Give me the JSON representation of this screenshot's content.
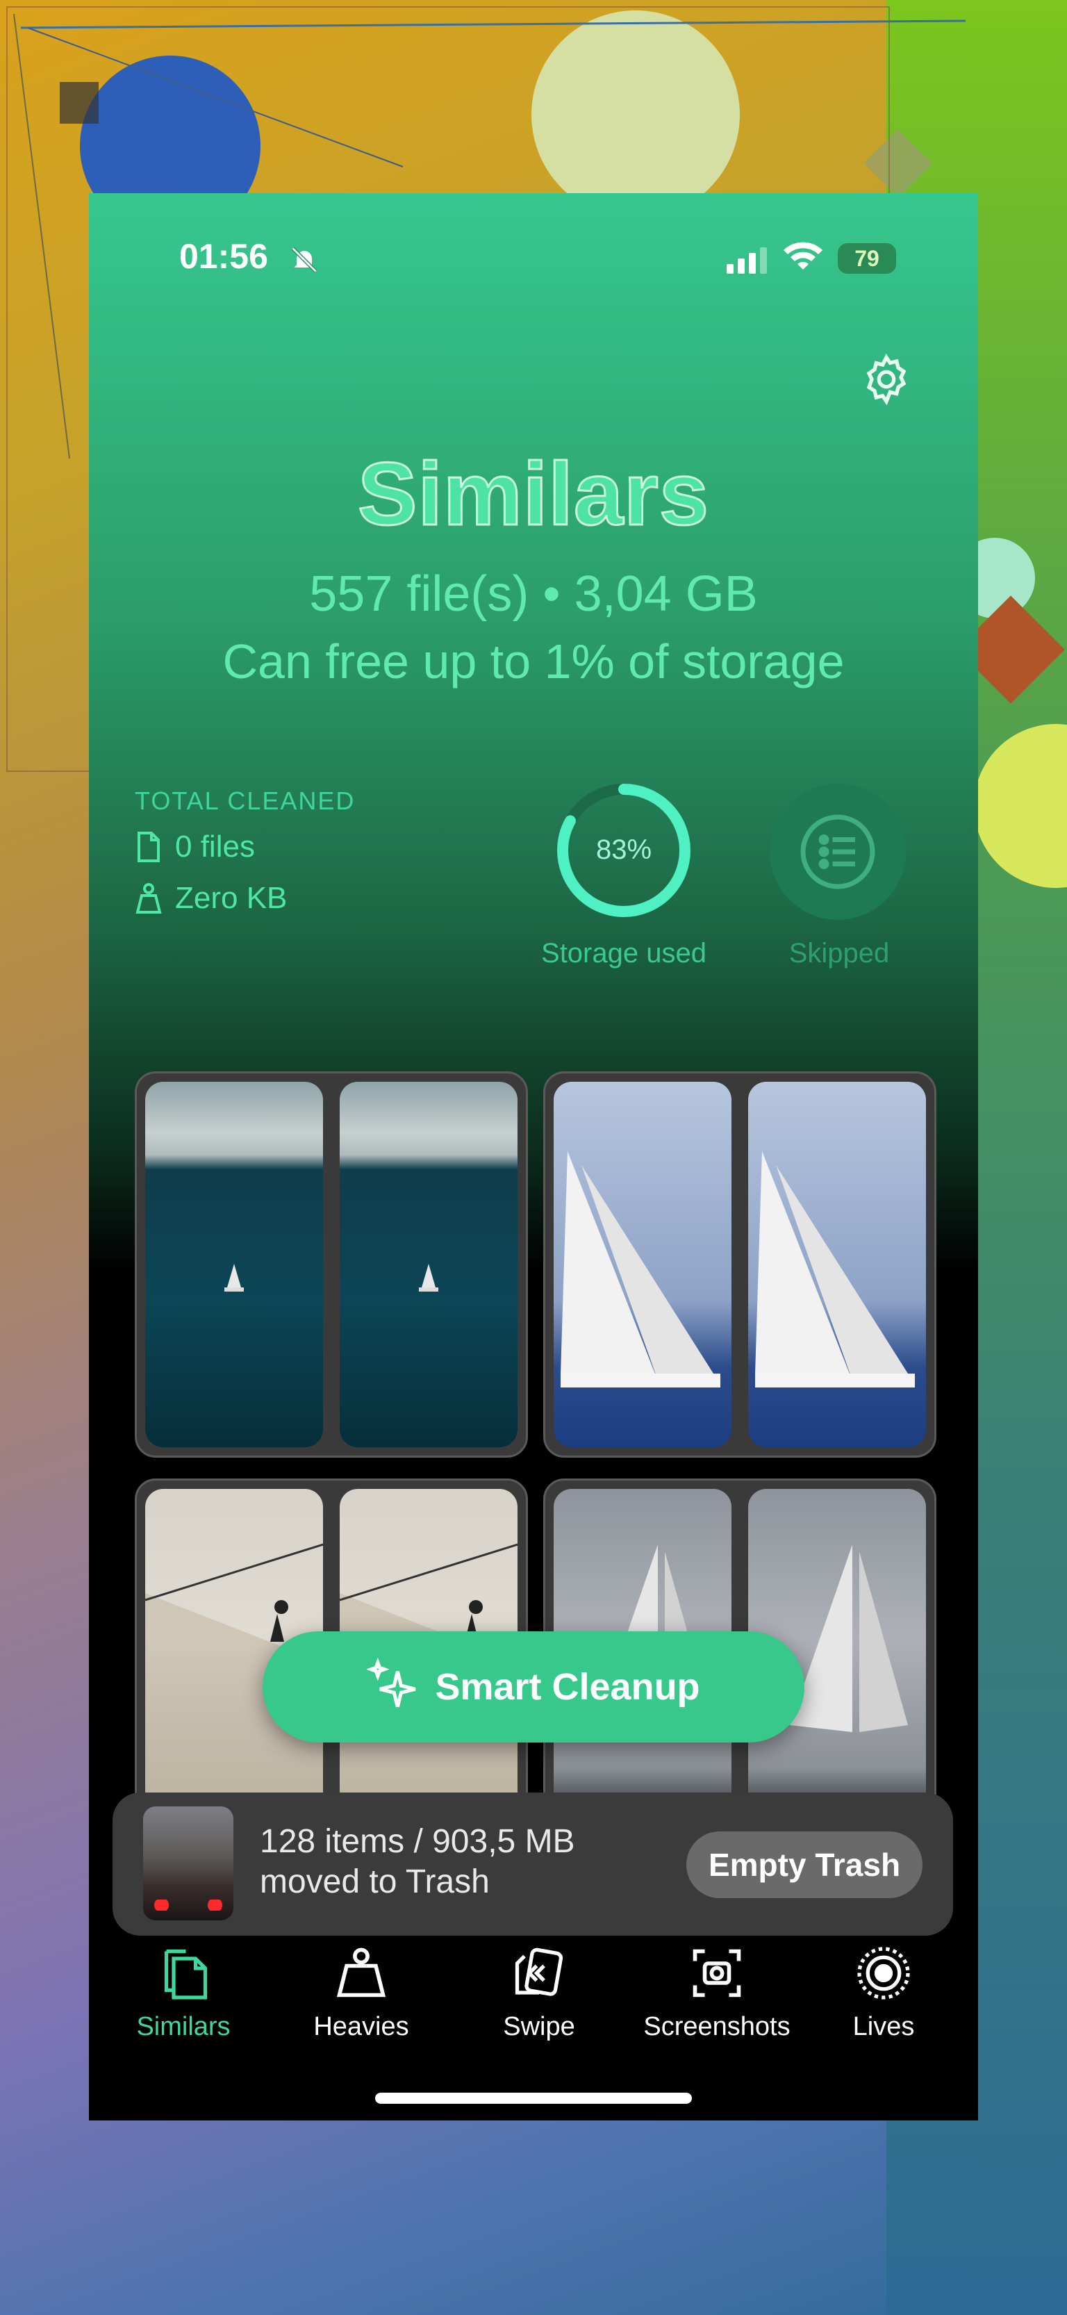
{
  "status_bar": {
    "time": "01:56",
    "battery": "79"
  },
  "header": {
    "title": "Similars",
    "summary": "557 file(s) • 3,04 GB",
    "free_note": "Can free up to 1% of storage"
  },
  "stats": {
    "total_cleaned_label": "TOTAL CLEANED",
    "files": "0 files",
    "size": "Zero KB",
    "storage_percent": "83%",
    "storage_fraction": 0.83,
    "storage_label": "Storage used",
    "skipped_label": "Skipped"
  },
  "smart_cleanup": {
    "label": "Smart Cleanup"
  },
  "trash_banner": {
    "line1": "128 items / 903,5 MB",
    "line2": "moved to Trash",
    "button": "Empty Trash"
  },
  "tabs": [
    {
      "label": "Similars",
      "icon": "similars-icon",
      "active": true
    },
    {
      "label": "Heavies",
      "icon": "weight-icon"
    },
    {
      "label": "Swipe",
      "icon": "swipe-icon"
    },
    {
      "label": "Screenshots",
      "icon": "screenshot-icon"
    },
    {
      "label": "Lives",
      "icon": "live-photo-icon"
    }
  ],
  "colors": {
    "accent": "#37c88c",
    "accent_text": "#4de3a6",
    "banner_bg": "#3b3b3b"
  }
}
